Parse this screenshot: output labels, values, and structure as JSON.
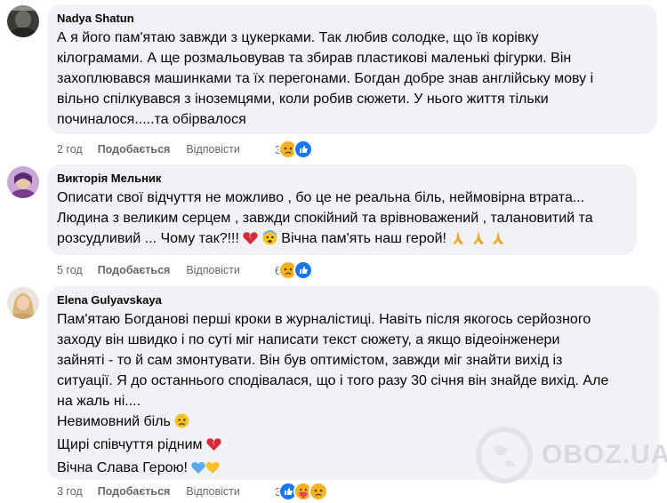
{
  "comments": [
    {
      "author": "Nadya Shatun",
      "lines": [
        "А я його пам'ятаю завжди з цукерками. Так любив солодке, що їв корівку",
        "кілограмами. А ще розмальовував та збирав пластикові маленькі фігурки. Він",
        "захоплювався машинками та їх перегонами. Богдан добре знав англійську мову і",
        "вільно спілкувався з іноземцями, коли робив сюжети. У нього життя тільки",
        "починалося.....та обірвалося"
      ],
      "time": "2 год",
      "like_label": "Подобається",
      "reply_label": "Відповісти",
      "reaction_count": "3",
      "reactions": [
        "sad",
        "like"
      ]
    },
    {
      "author": "Викторія Мельник",
      "lines": [
        "Описати свої відчуття не можливо , бо це не реальна біль, неймовірна втрата...",
        "Людина з великим серцем , завжди спокійний та врівноважений , талановитий та",
        "розсудливий ... Чому так?!!!",
        "Вічна пам'ять наш герой!"
      ],
      "time": "5 год",
      "like_label": "Подобається",
      "reply_label": "Відповісти",
      "reaction_count": "6",
      "reactions": [
        "sad",
        "like"
      ]
    },
    {
      "author": "Elena Gulyavskaya",
      "lines": [
        "Пам'ятаю Богданові перші кроки в журналістиці. Навіть після якогось серйозного",
        "заходу він швидко і по суті міг написати текст сюжету, а якщо відеоінженери",
        "зайняті - то й сам змонтувати. Він був оптимістом, завжди міг знайти вихід із",
        "ситуації. Я до останнього сподівалася, що і того разу 30 січня він знайде вихід. Але",
        "на жаль ні....",
        "Невимовний біль",
        "Щирі співчуття рідним",
        "Вічна Слава Герою!"
      ],
      "time": "3 год",
      "like_label": "Подобається",
      "reply_label": "Відповісти",
      "reaction_count": "3",
      "reactions": [
        "like",
        "care",
        "sad"
      ]
    }
  ],
  "watermark": "OBOZ.UA",
  "colors": {
    "bubble": "#f0f2f5",
    "meta": "#65676b",
    "like_blue": "#1877f2",
    "sad_yellow": "#f7b125"
  }
}
